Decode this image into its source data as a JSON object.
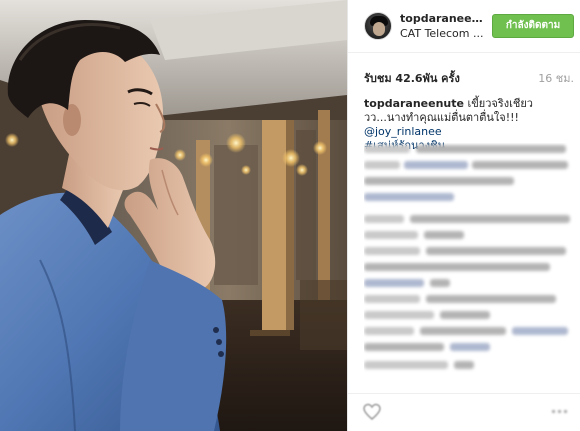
{
  "post": {
    "username": "topdaraneenute",
    "location": "CAT Telecom ...",
    "follow_label": "กำลังติดตาม",
    "views": "รับชม 42.6พัน ครั้ง",
    "time_ago": "16 ชม.",
    "caption": {
      "user": "topdaraneenute",
      "text": " เขี้ยวจริงเชียววว...นางทำคุณแม่ตื่นตาตื่นใจ!!! ",
      "mention": "@joy_rinlanee",
      "hashtag": "#เสน่ห์รักนางชิน"
    }
  },
  "comments": {
    "visibility": "blurred"
  },
  "footer": {
    "heart_icon": "heart-icon",
    "more_icon": "more-options-icon"
  },
  "colors": {
    "follow_button": "#70c050",
    "link": "#003569",
    "timestamp": "#a0a0a0"
  }
}
